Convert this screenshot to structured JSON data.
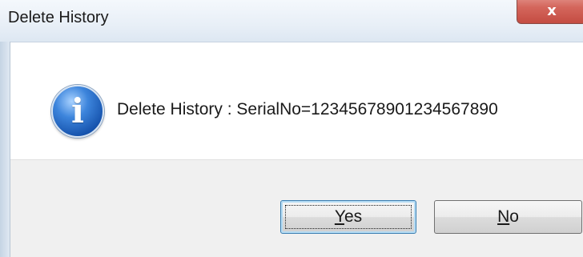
{
  "window": {
    "title": "Delete History",
    "close_glyph": "x"
  },
  "dialog": {
    "icon": "info-icon",
    "message": "Delete History : SerialNo=12345678901234567890"
  },
  "buttons": {
    "yes": {
      "mnemonic": "Y",
      "rest": "es"
    },
    "no": {
      "mnemonic": "N",
      "rest": "o"
    }
  },
  "colors": {
    "titlebar": "#e8eff7",
    "close_button": "#d4665c",
    "footer": "#f0f0f0",
    "icon_blue": "#1653ad"
  }
}
